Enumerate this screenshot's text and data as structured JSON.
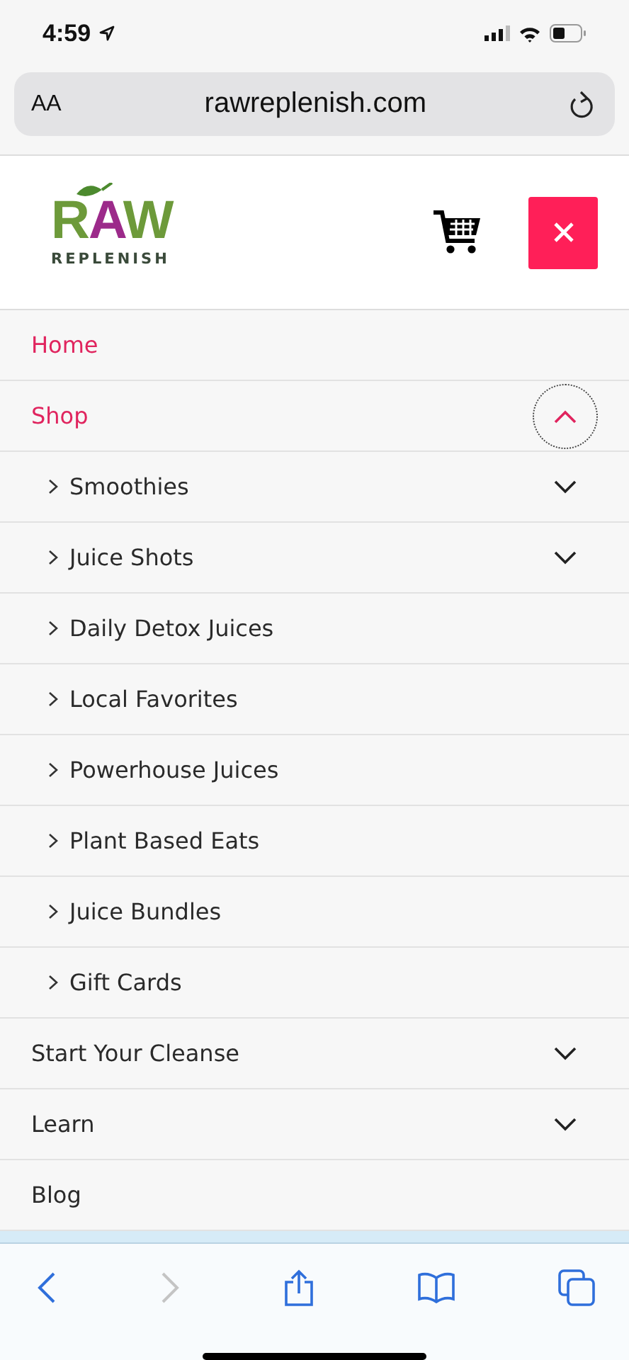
{
  "status_bar": {
    "time": "4:59"
  },
  "url_bar": {
    "text_size": "AA",
    "url": "rawreplenish.com"
  },
  "logo": {
    "word": "RAW",
    "tagline": "REPLENISH"
  },
  "menu": [
    {
      "label": "Home",
      "active": true
    },
    {
      "label": "Shop",
      "active": true,
      "expanded": true,
      "children": [
        {
          "label": "Smoothies",
          "expanded": false
        },
        {
          "label": "Juice Shots",
          "expanded": false
        },
        {
          "label": "Daily Detox Juices"
        },
        {
          "label": "Local Favorites"
        },
        {
          "label": "Powerhouse Juices"
        },
        {
          "label": "Plant Based Eats"
        },
        {
          "label": "Juice Bundles"
        },
        {
          "label": "Gift Cards"
        }
      ]
    },
    {
      "label": "Start Your Cleanse",
      "active": false,
      "expanded": false
    },
    {
      "label": "Learn",
      "active": false,
      "expanded": false
    },
    {
      "label": "Blog",
      "active": false
    }
  ],
  "toolbar": {
    "back_enabled": true,
    "forward_enabled": false
  }
}
